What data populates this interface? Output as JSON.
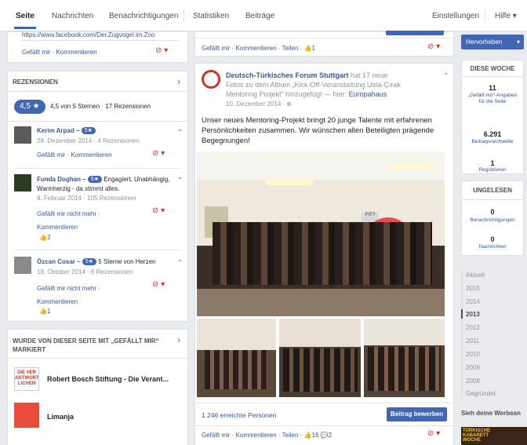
{
  "tabs": [
    "Seite",
    "Nachrichten",
    "Benachrichtigungen",
    "Statistiken",
    "Beiträge"
  ],
  "tabs_right": [
    "Einstellungen",
    "Hilfe ▾"
  ],
  "leftTop": {
    "url": "https://www.facebook.com/Der.Zugvogel.im.Zoo",
    "actions": "Gefällt mir · Kommentieren"
  },
  "reviews": {
    "header": "REZENSIONEN",
    "rating": "4,5 ★",
    "summary": "4,5 von 5 Sternen · 17 Rezensionen",
    "items": [
      {
        "name": "Kerim Arpad –",
        "stars": "5★",
        "text": "",
        "meta": "28. Dezember 2014 · 4 Rezensionen",
        "actions": "Gefällt mir · Kommentieren",
        "likes": ""
      },
      {
        "name": "Funda Doghan –",
        "stars": "5★",
        "text": "Engagiert, Unabhängig, Warmherzig - da stimmt alles.",
        "meta": "8. Februar 2014 · 105 Rezensionen",
        "actions": "Gefällt mir nicht mehr · Kommentieren",
        "likes": "2"
      },
      {
        "name": "Özcan Cosar –",
        "stars": "5★",
        "text": "5 Sterne von Herzen",
        "meta": "19. Oktober 2014 · 6 Rezensionen",
        "actions": "Gefällt mir nicht mehr · Kommentieren",
        "likes": "1"
      }
    ]
  },
  "liked": {
    "header": "WURDE VON DIESER SEITE MIT „GEFÄLLT MIR“ MARKIERT",
    "items": [
      "Robert Bosch Stiftung - Die Verant...",
      "Limanja"
    ],
    "logo_text": "DIE VER ANTWORT LICHEN"
  },
  "post_top": {
    "actions": "Gefällt mir · Kommentieren · Teilen ·",
    "likes": "1"
  },
  "post": {
    "author": "Deutsch-Türkisches Forum Stuttgart",
    "meta1": " hat 17 neue",
    "meta2": "Fotos zu dem Album „Kick-Off-Veranstaltung Usta-Çırak",
    "meta3": "Mentoring Projekt“ hinzugefügt — hier: ",
    "place": "Europahaus",
    "date": "10. Dezember 2014 · ⊕",
    "text": "Unser neues Mentoring-Projekt bringt 20 junge Talente mit erfahrenen Persönlichkeiten zusammen. Wir wünschen allen Beteiligten prägende Begegnungen!",
    "reach": "1.246 erreichte Personen",
    "promote": "Beitrag bewerben",
    "actions": "Gefällt mir · Kommentieren · Teilen ·",
    "likes": "16",
    "comments": "2",
    "photo_sign": "FIT?"
  },
  "sidebar": {
    "highlight": "Hervorheben",
    "week_header": "DIESE WOCHE",
    "stats": [
      {
        "num": "11",
        "label": "„Gefällt mir“-Angaben für die Seite"
      },
      {
        "num": "6.291",
        "label": "Beitragsreichweite"
      },
      {
        "num": "1",
        "label": "Registrieren"
      }
    ],
    "unread_header": "UNGELESEN",
    "unread": [
      {
        "num": "0",
        "label": "Benachrichtigungen"
      },
      {
        "num": "0",
        "label": "Nachrichten"
      }
    ],
    "years": [
      "Aktuell",
      "2015",
      "2014",
      "2013",
      "2012",
      "2011",
      "2010",
      "2009",
      "2008",
      "Gegründet"
    ],
    "ad_header": "Sieh deine Werbean",
    "ad_text": "TÜRKISCHE KABARETT WOCHE"
  }
}
